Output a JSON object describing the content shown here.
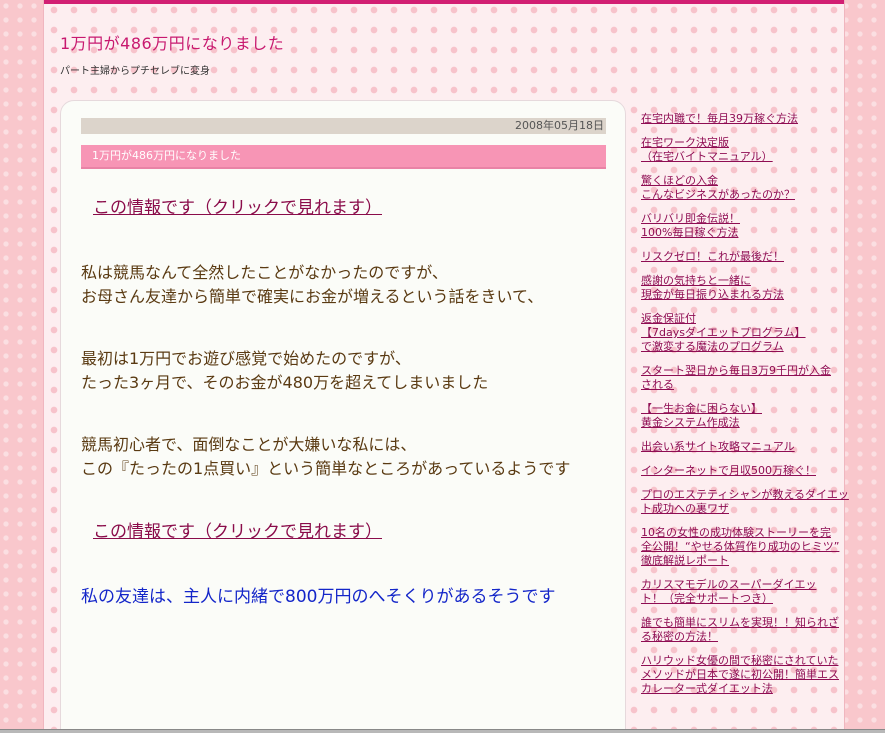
{
  "site": {
    "title": "1万円が486万円になりました",
    "description": "パート主婦からプチセレブに変身"
  },
  "entry": {
    "date": "2008年05月18日",
    "title": "1万円が486万円になりました",
    "link1": "この情報です（クリックで見れます）",
    "para1_line1": "私は競馬なんて全然したことがなかったのですが、",
    "para1_line2": "お母さん友達から簡単で確実にお金が増えるという話をきいて、",
    "para2_line1": "最初は1万円でお遊び感覚で始めたのですが、",
    "para2_line2": "たった3ヶ月で、そのお金が480万を超えてしまいました",
    "para3_line1": "競馬初心者で、面倒なことが大嫌いな私には、",
    "para3_line2": "この『たったの1点買い』という簡単なところがあっているようです",
    "link2": "この情報です（クリックで見れます）",
    "blue_line": "私の友達は、主人に内緒で800万円のへそくりがあるそうです"
  },
  "sidebar": {
    "links": [
      "在宅内職で！毎月39万稼ぐ方法",
      "在宅ワーク決定版\n（在宅バイトマニュアル）",
      "驚くほどの入金\nこんなビジネスがあったのか？",
      "バリバリ即金伝説！\n100%毎日稼ぐ方法",
      "リスクゼロ！これが最後だ！",
      "感謝の気持ちと一緒に\n現金が毎日振り込まれる方法",
      "返金保証付\n【7daysダイエットプログラム】\nで激変する魔法のプログラム",
      "スタート翌日から毎日3万9千円が入金\nされる",
      "【一生お金に困らない】\n黄金システム作成法",
      "出会い系サイト攻略マニュアル",
      "インターネットで月収500万稼ぐ！",
      "プロのエステティシャンが教えるダイエッ\nト成功への裏ワザ",
      "10名の女性の成功体験ストーリーを完\n全公開！“やせる体質作り成功のヒミツ”\n徹底解説レポート",
      "カリスマモデルのスーパーダイエッ\nト！（完全サポートつき）",
      "誰でも簡単にスリムを実現！！知られざ\nる秘密の方法！",
      "ハリウッド女優の間で秘密にされていた\nメソッドが日本で遂に初公開！簡単エス\nカレーター式ダイエット法"
    ]
  },
  "colors": {
    "accent": "#d21f73",
    "title": "#c8196f",
    "entry_bar": "#f795b5",
    "link": "#8f0d53",
    "blue_text": "#1426c9"
  }
}
